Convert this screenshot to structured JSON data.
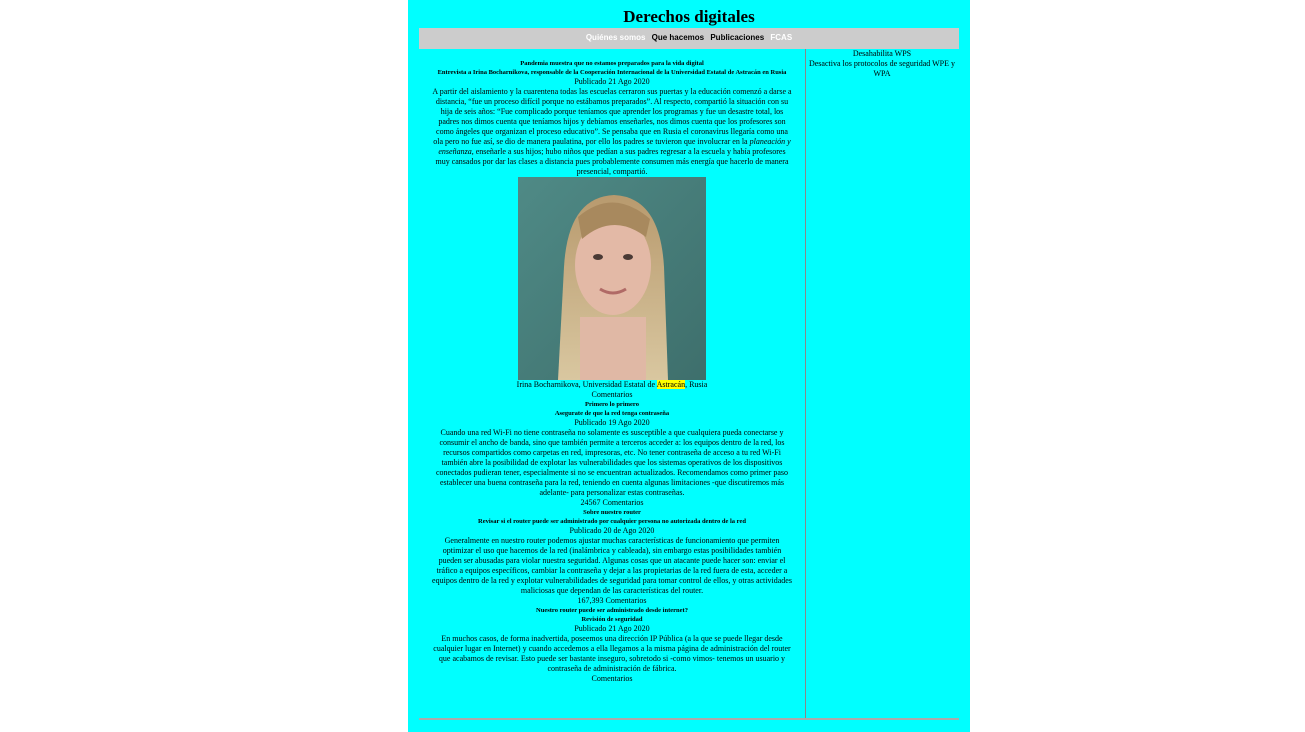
{
  "site_title": "Derechos digitales",
  "nav": [
    "Quiénes somos",
    "Que hacemos",
    "Publicaciones",
    "FCAS"
  ],
  "sidebar": [
    "Desahabilita WPS",
    "Desactiva los protocolos de seguridad WPE y WPA"
  ],
  "article1": {
    "headline": "Pandemia muestra que no estamos preparados para la vida digital",
    "subhead": "Entrevista a Irina Bocharnikova, responsable de la Cooperación Internacional de la Universidad Estatal de Astracán en Rusia",
    "date": "Publicado 21 Ago 2020",
    "body_a": "A partir del aislamiento y la cuarentena todas las escuelas cerraron sus puertas y la educación comenzó a darse a distancia, “fue un proceso difícil porque no estábamos preparados”. Al respecto, compartió la situación con su hija de seis años: “Fue complicado porque teníamos que aprender los programas y fue un desastre total, los padres nos dimos cuenta que teníamos hijos y debíamos enseñarles, nos dimos cuenta que los profesores son como ángeles que organizan el proceso educativo”. Se pensaba que en Rusia el coronavirus llegaría como una ola pero no fue así, se dio de manera paulatina, por ello los padres se tuvieron que involucrar en la",
    "body_em": "planeación y enseñanza",
    "body_b": ", enseñarle a sus hijos; hubo niños que pedían a sus padres regresar a la escuela y había profesores muy cansados por dar las clases a distancia pues probablemente consumen más energía que hacerlo de manera presencial, compartió.",
    "caption_a": "Irina Bocharnikova, Universidad Estatal de ",
    "caption_hl": "Astracán",
    "caption_b": ", Rusia",
    "comments": "Comentarios"
  },
  "article2": {
    "headline": "Primero lo primero",
    "subhead": "Asegurate de que la red tenga contraseña",
    "date": "Publicado 19 Ago 2020",
    "body": "Cuando una red Wi-Fi no tiene contraseña no solamente es susceptible a que cualquiera pueda conectarse y consumir el ancho de banda, sino que también permite a terceros acceder a: los equipos dentro de la red, los recursos compartidos como carpetas en red, impresoras, etc. No tener contraseña de acceso a tu red Wi-Fi también abre la posibilidad de explotar las vulnerabilidades que los sistemas operativos de los dispositivos conectados pudieran tener, especialmente si no se encuentran actualizados. Recomendamos como primer paso establecer una buena contraseña para la red, teniendo en cuenta algunas limitaciones -que discutiremos más adelante- para personalizar estas contraseñas.",
    "comments": "24567 Comentarios"
  },
  "article3": {
    "headline": "Sobre nuestro router",
    "subhead": "Revisar si el router puede ser administrado por cualquier persona no autorizada dentro de la red",
    "date": "Publicado 20 de Ago 2020",
    "body": "Generalmente en nuestro router podemos ajustar muchas características de funcionamiento que permiten optimizar el uso que hacemos de la red (inalámbrica y cableada), sin embargo estas posibilidades también pueden ser abusadas para violar nuestra seguridad. Algunas cosas que un atacante puede hacer son: enviar el tráfico a equipos específicos, cambiar la contraseña y dejar a las propietarias de la red fuera de esta, acceder a equipos dentro de la red y explotar vulnerabilidades de seguridad para tomar control de ellos, y otras actividades maliciosas que dependan de las características del router.",
    "comments": "167,393 Comentarios"
  },
  "article4": {
    "headline": "Nuestro router puede ser administrado desde internet?",
    "subhead": "Revisión de seguridad",
    "date": "Publicado 21 Ago 2020",
    "body": "En muchos casos, de forma inadvertida, poseemos una dirección IP Pública (a la que se puede llegar desde cualquier lugar en Internet) y cuando accedemos a ella llegamos a la misma página de administración del router que acabamos de revisar. Esto puede ser bastante inseguro, sobretodo si -como vimos- tenemos un usuario y contraseña de administración de fábrica.",
    "comments": "Comentarios"
  }
}
